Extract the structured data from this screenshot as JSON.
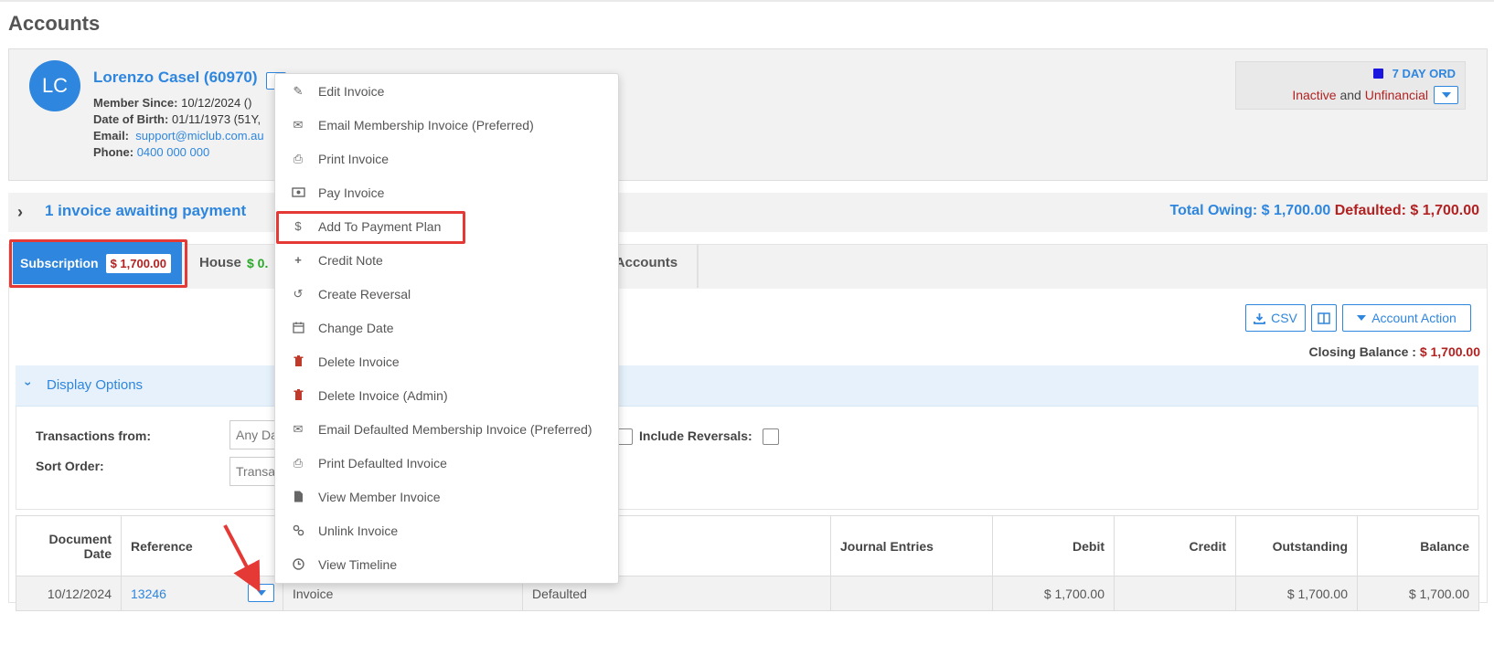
{
  "page": {
    "title": "Accounts"
  },
  "member": {
    "initials": "LC",
    "name": "Lorenzo Casel (60970)",
    "member_since_label": "Member Since:",
    "member_since_value": "10/12/2024 ()",
    "dob_label": "Date of Birth:",
    "dob_value": "01/11/1973 (51Y,",
    "email_label": "Email:",
    "email_value": "support@miclub.com.au",
    "phone_label": "Phone:",
    "phone_value": "0400 000 000"
  },
  "status": {
    "category": "7 DAY ORD",
    "category_color": "#1a16e0",
    "inactive": "Inactive",
    "and": "and",
    "unfinancial": "Unfinancial"
  },
  "invoice_bar": {
    "awaiting": "1 invoice awaiting payment",
    "total_owing": "Total Owing: $ 1,700.00",
    "defaulted": "Defaulted: $ 1,700.00"
  },
  "tabs": {
    "subscription_label": "Subscription",
    "subscription_amount": "$ 1,700.00",
    "house_label": "House",
    "house_amount": "$ 0.",
    "accounts_label": "l Accounts"
  },
  "toolbar": {
    "csv": "CSV",
    "account_action": "Account Action",
    "closing_label": "Closing Balance :",
    "closing_value": "$ 1,700.00"
  },
  "display_options": {
    "label": "Display Options",
    "transactions_from": "Transactions from:",
    "transactions_from_value": "Any Da",
    "sort_order": "Sort Order:",
    "sort_order_value": "Transa",
    "include_reversals": "Include Reversals:"
  },
  "table": {
    "headers": {
      "document_date": "Document Date",
      "reference": "Reference",
      "journal_entries": "Journal Entries",
      "debit": "Debit",
      "credit": "Credit",
      "outstanding": "Outstanding",
      "balance": "Balance"
    },
    "rows": [
      {
        "date": "10/12/2024",
        "reference": "13246",
        "type": "Invoice",
        "status": "Defaulted",
        "journal": "",
        "debit": "$ 1,700.00",
        "credit": "",
        "outstanding": "$ 1,700.00",
        "balance": "$ 1,700.00"
      }
    ]
  },
  "menu": {
    "items": [
      {
        "label": "Edit Invoice",
        "icon": "pencil-icon"
      },
      {
        "label": "Email Membership Invoice (Preferred)",
        "icon": "envelope-icon"
      },
      {
        "label": "Print Invoice",
        "icon": "printer-icon"
      },
      {
        "label": "Pay Invoice",
        "icon": "money-icon"
      },
      {
        "label": "Add To Payment Plan",
        "icon": "dollar-icon"
      },
      {
        "label": "Credit Note",
        "icon": "plus-icon"
      },
      {
        "label": "Create Reversal",
        "icon": "undo-icon"
      },
      {
        "label": "Change Date",
        "icon": "calendar-icon"
      },
      {
        "label": "Delete Invoice",
        "icon": "trash-icon"
      },
      {
        "label": "Delete Invoice (Admin)",
        "icon": "trash-icon"
      },
      {
        "label": "Email Defaulted Membership Invoice (Preferred)",
        "icon": "envelope-icon"
      },
      {
        "label": "Print Defaulted Invoice",
        "icon": "printer-icon"
      },
      {
        "label": "View Member Invoice",
        "icon": "file-icon"
      },
      {
        "label": "Unlink Invoice",
        "icon": "unlink-icon"
      },
      {
        "label": "View Timeline",
        "icon": "clock-icon"
      }
    ]
  },
  "colors": {
    "accent": "#2e86de",
    "danger": "#b22222",
    "success": "#2aa829",
    "highlight": "#e53935"
  }
}
